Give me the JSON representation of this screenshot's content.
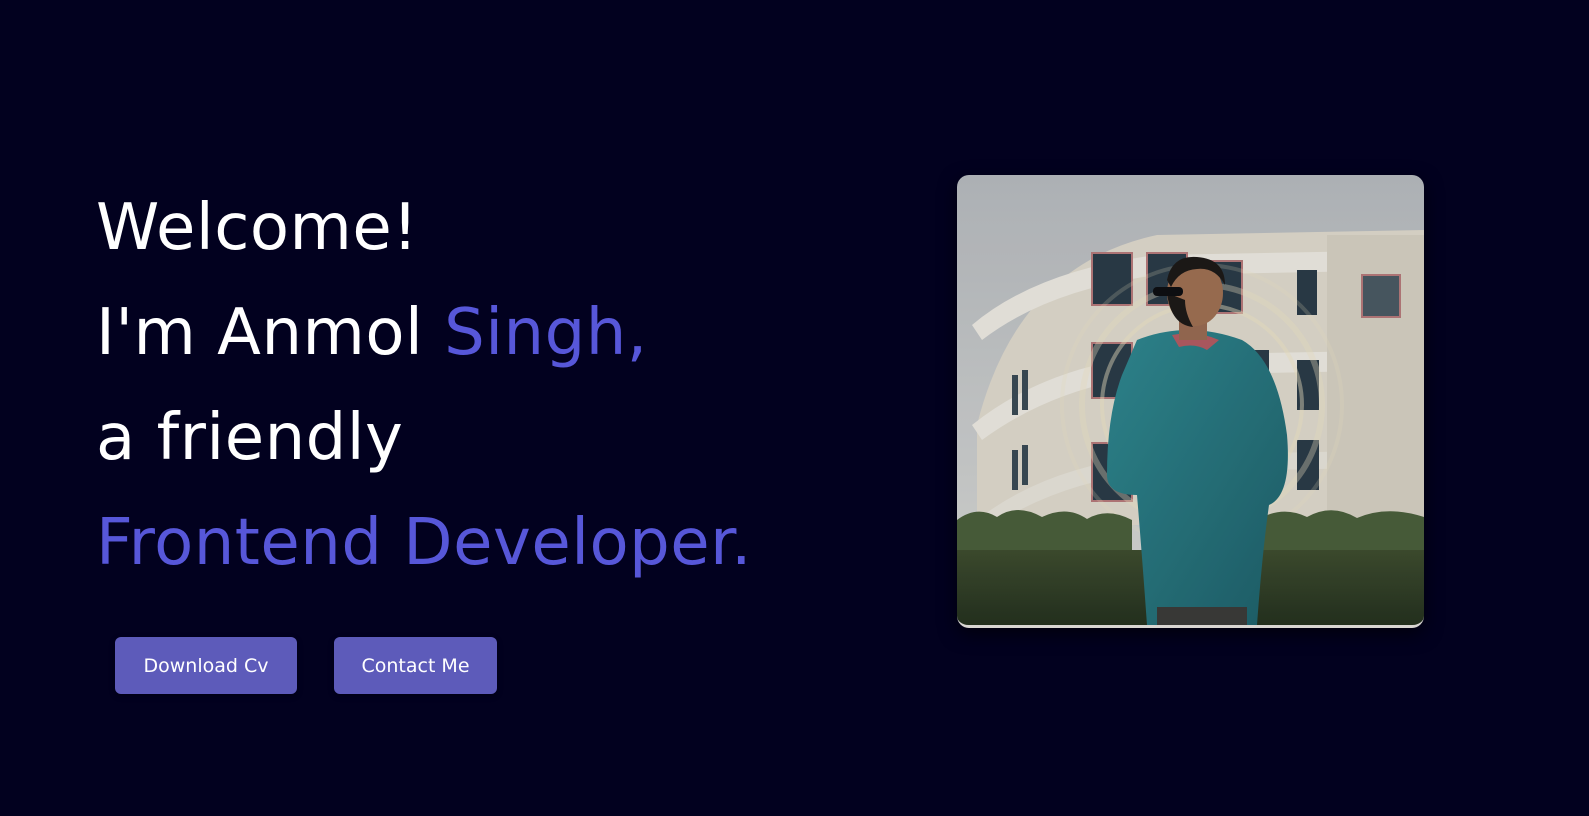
{
  "hero": {
    "line1": "Welcome!",
    "line2_prefix": "I'm Anmol ",
    "line2_accent": "Singh,",
    "line3": "a friendly",
    "line4": "Frontend Developer."
  },
  "buttons": {
    "download_label": "Download Cv",
    "contact_label": "Contact Me"
  },
  "colors": {
    "background": "#02011f",
    "accent": "#5757d9",
    "button": "#5d5bba"
  }
}
